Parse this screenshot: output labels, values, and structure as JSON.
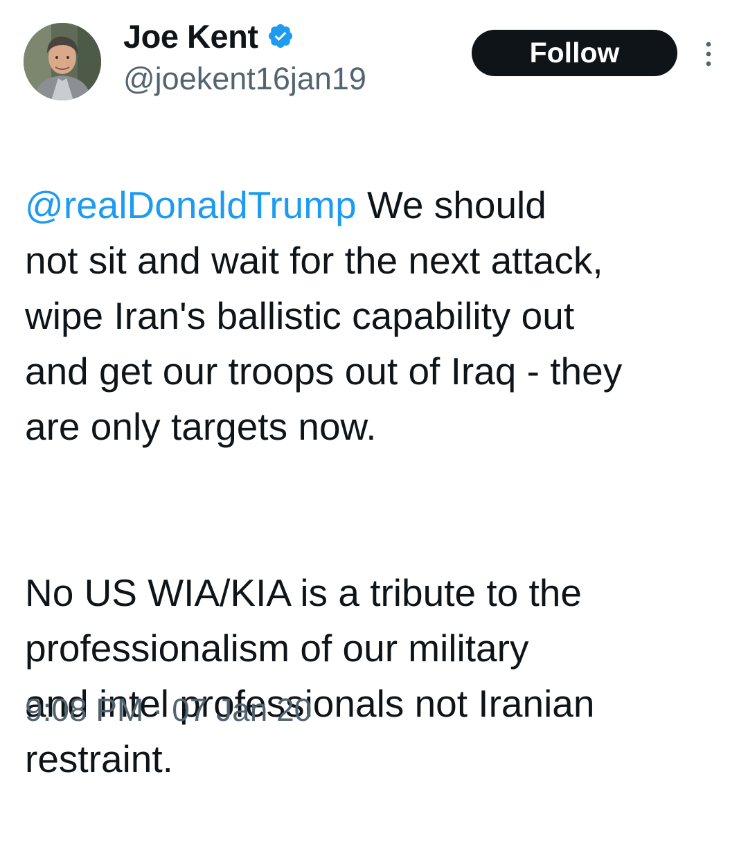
{
  "author": {
    "display_name": "Joe Kent",
    "handle": "@joekent16jan19",
    "verified": true,
    "avatar_icon": "profile-photo"
  },
  "actions": {
    "follow_label": "Follow",
    "more_icon": "more-vertical-icon"
  },
  "tweet": {
    "mention": "@realDonaldTrump",
    "paragraph_1_rest": "We should\nnot sit and wait for the next attack,\nwipe Iran's ballistic capability out\nand get our troops out of Iraq - they\nare only targets now.",
    "paragraph_2": "No US WIA/KIA is a tribute to the\nprofessionalism of our military\nand intel professionals not Iranian\nrestraint."
  },
  "meta": {
    "time": "9:08 PM",
    "separator": "·",
    "date": "07 Jan 20"
  },
  "colors": {
    "link": "#1d9bf0",
    "verified_badge": "#1d9bf0",
    "secondary_text": "#536471",
    "primary_text": "#0f1419",
    "button_bg": "#0f1419"
  }
}
